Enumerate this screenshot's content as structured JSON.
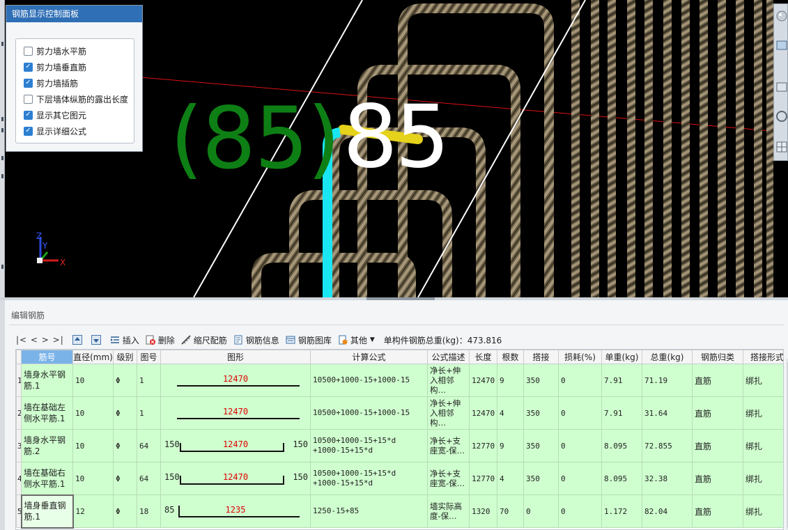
{
  "viewport": {
    "label_green": "(85)",
    "label_white": "85",
    "axis": {
      "z": "Z",
      "y": "Y",
      "x": "X"
    }
  },
  "control_panel": {
    "title": "钢筋显示控制面板",
    "options": [
      {
        "label": "剪力墙水平筋",
        "checked": false
      },
      {
        "label": "剪力墙垂直筋",
        "checked": true
      },
      {
        "label": "剪力墙插筋",
        "checked": true
      },
      {
        "label": "下层墙体纵筋的露出长度",
        "checked": false
      },
      {
        "label": "显示其它图元",
        "checked": true
      },
      {
        "label": "显示详细公式",
        "checked": true
      }
    ]
  },
  "editor": {
    "title": "编辑钢筋",
    "toolbar": {
      "nav": "|<  <  >  >|",
      "insert": "插入",
      "delete": "删除",
      "scale_config": "缩尺配筋",
      "rebar_info": "钢筋信息",
      "rebar_library": "钢筋图库",
      "other": "其他",
      "total_weight": "单构件钢筋总重(kg)：473.816"
    },
    "columns": [
      "筋号",
      "直径(mm)",
      "级别",
      "图号",
      "图形",
      "计算公式",
      "公式描述",
      "长度",
      "根数",
      "搭接",
      "损耗(%)",
      "单重(kg)",
      "总重(kg)",
      "钢筋归类",
      "搭接形式"
    ],
    "rows": [
      {
        "num": "1",
        "name": "墙身水平钢筋.1",
        "dia": "10",
        "grade": "Φ",
        "fig": "1",
        "shape_left": "",
        "shape_mid": "12470",
        "shape_right": "",
        "formula": "10500+1000-15+1000-15",
        "desc": "净长+伸入相邻构…",
        "length": "12470",
        "count": "9",
        "lap": "350",
        "loss": "0",
        "unit_w": "7.91",
        "total_w": "71.19",
        "category": "直筋",
        "lap_type": "绑扎"
      },
      {
        "num": "2",
        "name": "墙在基础左侧水平筋.1",
        "dia": "10",
        "grade": "Φ",
        "fig": "1",
        "shape_left": "",
        "shape_mid": "12470",
        "shape_right": "",
        "formula": "10500+1000-15+1000-15",
        "desc": "净长+伸入相邻构…",
        "length": "12470",
        "count": "4",
        "lap": "350",
        "loss": "0",
        "unit_w": "7.91",
        "total_w": "31.64",
        "category": "直筋",
        "lap_type": "绑扎"
      },
      {
        "num": "3",
        "name": "墙身水平钢筋.2",
        "dia": "10",
        "grade": "Φ",
        "fig": "64",
        "shape_left": "150",
        "shape_mid": "12470",
        "shape_right": "150",
        "formula": "10500+1000-15+15*d +1000-15+15*d",
        "desc": "净长+支座宽-保…",
        "length": "12770",
        "count": "9",
        "lap": "350",
        "loss": "0",
        "unit_w": "8.095",
        "total_w": "72.855",
        "category": "直筋",
        "lap_type": "绑扎"
      },
      {
        "num": "4",
        "name": "墙在基础右侧水平筋.1",
        "dia": "10",
        "grade": "Φ",
        "fig": "64",
        "shape_left": "150",
        "shape_mid": "12470",
        "shape_right": "150",
        "formula": "10500+1000-15+15*d +1000-15+15*d",
        "desc": "净长+支座宽-保…",
        "length": "12770",
        "count": "4",
        "lap": "350",
        "loss": "0",
        "unit_w": "8.095",
        "total_w": "32.38",
        "category": "直筋",
        "lap_type": "绑扎"
      },
      {
        "num": "5",
        "name": "墙身垂直钢筋.1",
        "dia": "12",
        "grade": "Φ",
        "fig": "18",
        "shape_left": "85",
        "shape_mid": "1235",
        "shape_right": "",
        "formula": "1250-15+85",
        "desc": "墙实际高度-保…",
        "length": "1320",
        "count": "70",
        "lap": "0",
        "loss": "0",
        "unit_w": "1.172",
        "total_w": "82.04",
        "category": "直筋",
        "lap_type": "绑扎"
      }
    ]
  },
  "colors": {
    "selection_green": "#cfffcf",
    "panel_title_blue": "#2f6fb6",
    "checkbox_blue": "#2d7fd2",
    "shape_value_red": "#e00000",
    "label_green": "#0e7f14"
  }
}
